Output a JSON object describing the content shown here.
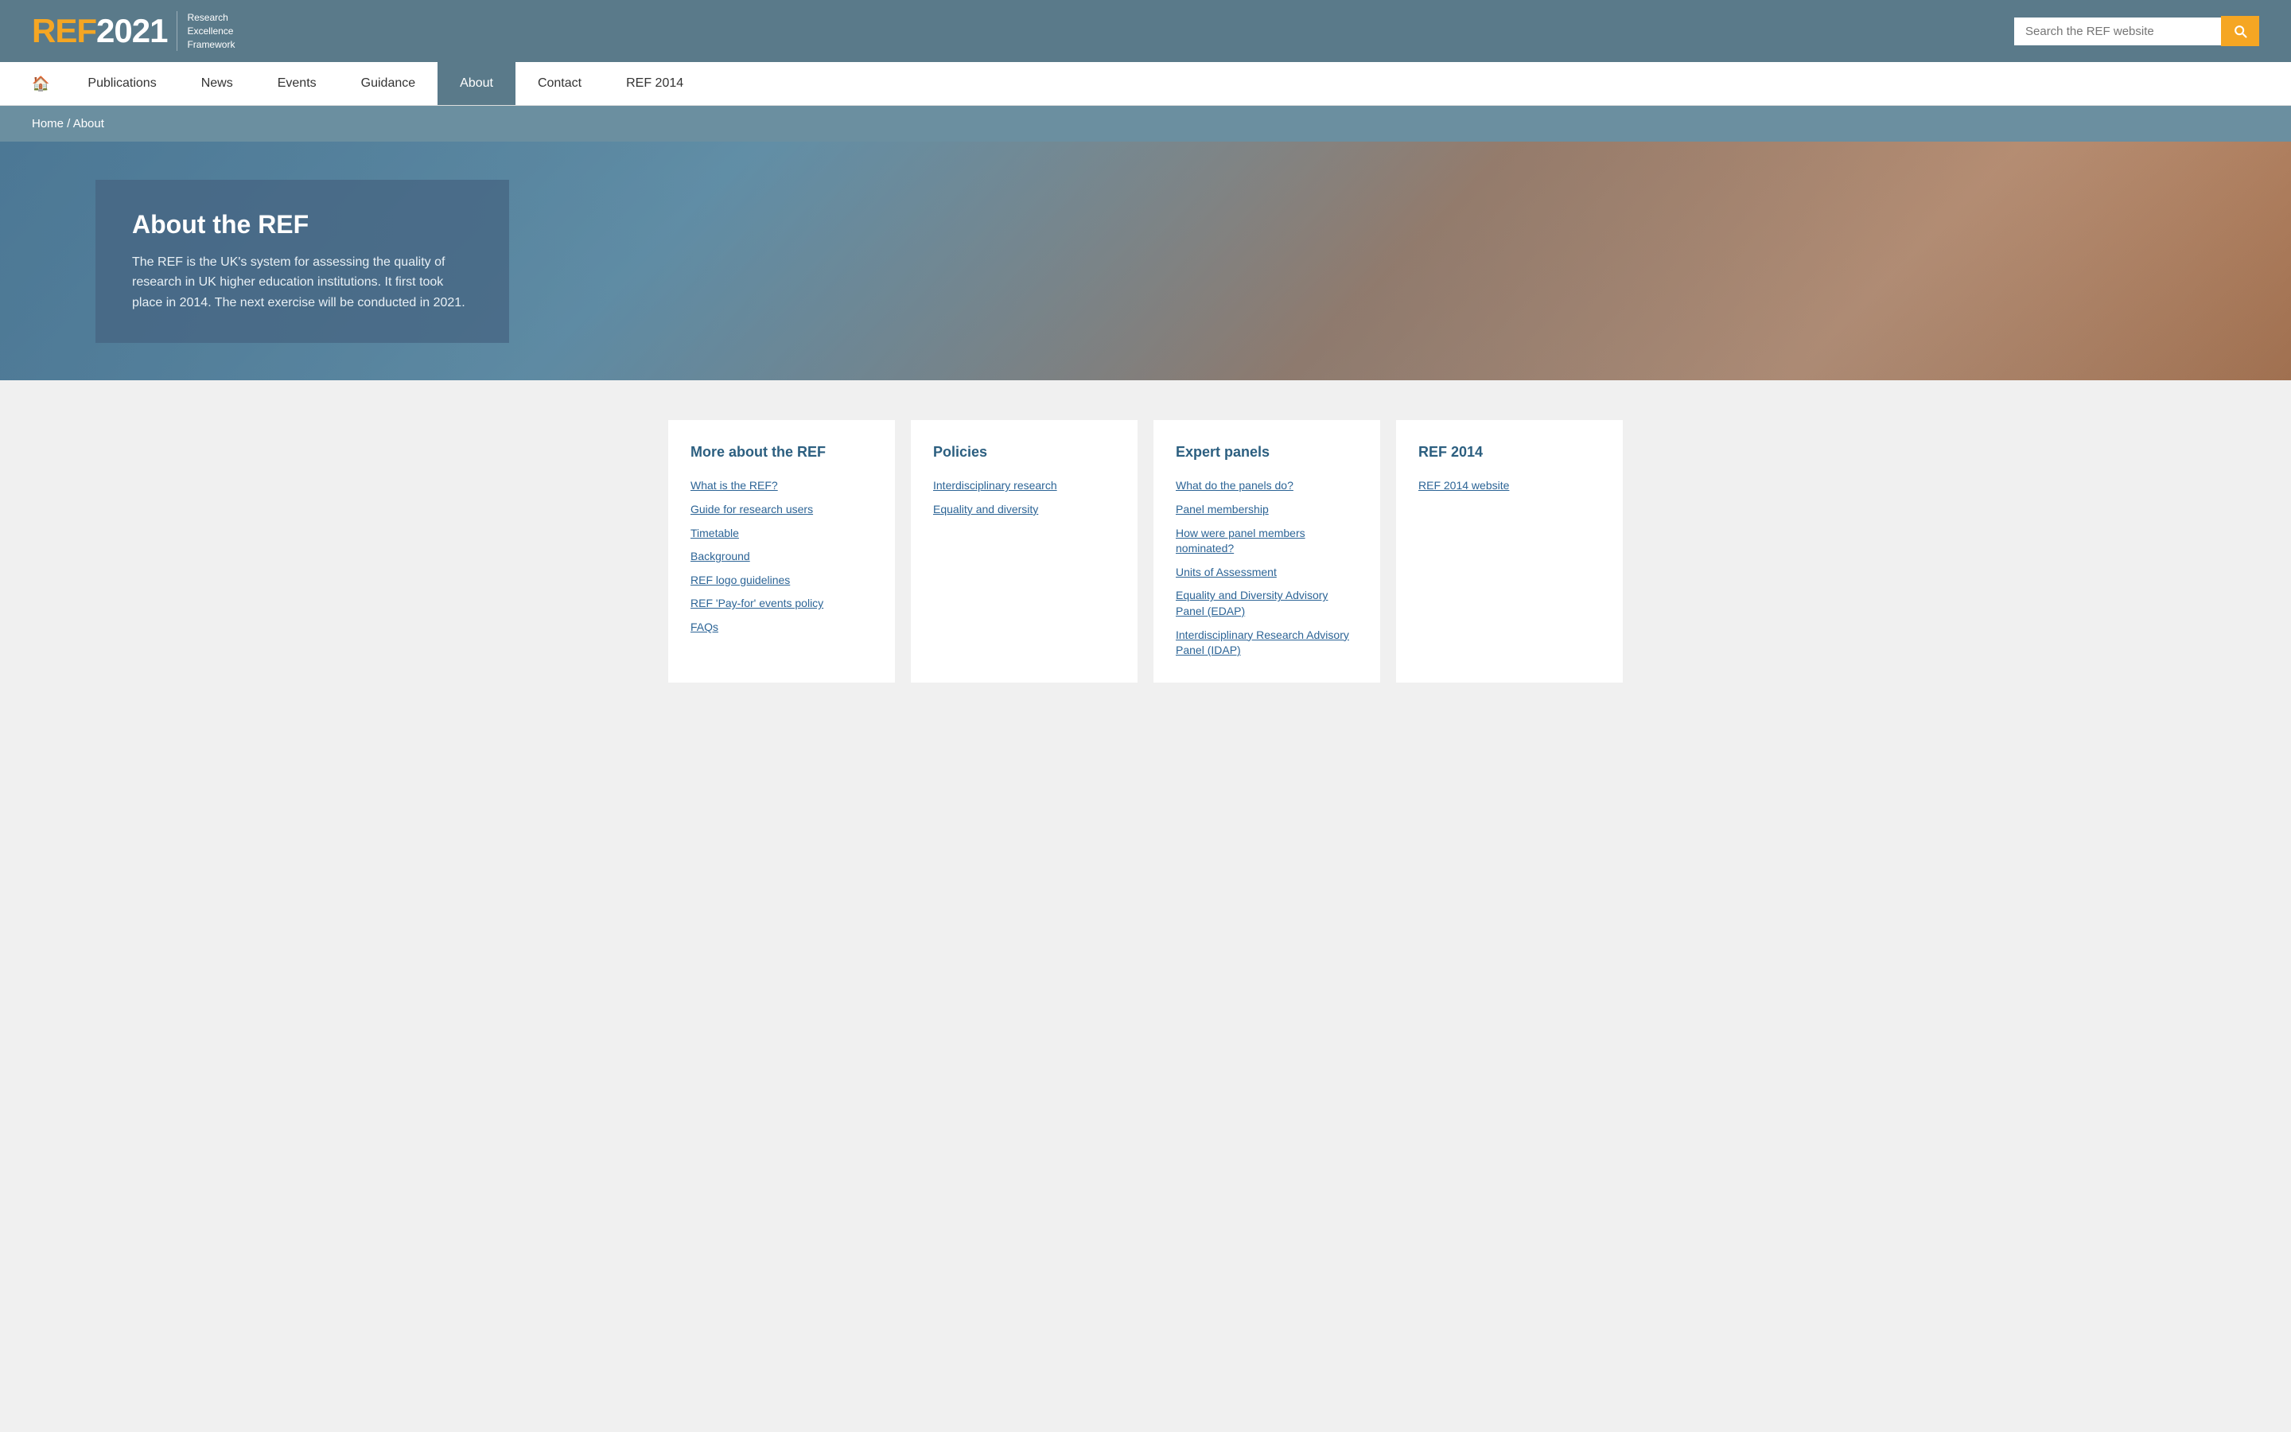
{
  "header": {
    "logo_ref": "REF",
    "logo_year": "2021",
    "logo_line1": "Research",
    "logo_line2": "Excellence",
    "logo_line3": "Framework",
    "search_placeholder": "Search the REF website"
  },
  "nav": {
    "home_icon": "🏠",
    "items": [
      {
        "label": "Publications",
        "active": false
      },
      {
        "label": "News",
        "active": false
      },
      {
        "label": "Events",
        "active": false
      },
      {
        "label": "Guidance",
        "active": false
      },
      {
        "label": "About",
        "active": true
      },
      {
        "label": "Contact",
        "active": false
      },
      {
        "label": "REF 2014",
        "active": false
      }
    ]
  },
  "breadcrumb": {
    "home": "Home",
    "separator": " / ",
    "current": "About"
  },
  "hero": {
    "title": "About the REF",
    "description": "The REF is the UK's system for assessing the quality of research in UK higher education institutions. It first took place in 2014. The next exercise will be conducted in 2021."
  },
  "cards": [
    {
      "id": "more-about",
      "title": "More about the REF",
      "links": [
        "What is the REF?",
        "Guide for research users",
        "Timetable",
        "Background",
        "REF logo guidelines",
        "REF 'Pay-for' events policy",
        "FAQs"
      ]
    },
    {
      "id": "policies",
      "title": "Policies",
      "links": [
        "Interdisciplinary research",
        "Equality and diversity"
      ]
    },
    {
      "id": "expert-panels",
      "title": "Expert panels",
      "links": [
        "What do the panels do?",
        "Panel membership",
        "How were panel members nominated?",
        "Units of Assessment",
        "Equality and Diversity Advisory Panel (EDAP)",
        "Interdisciplinary Research Advisory Panel (IDAP)"
      ]
    },
    {
      "id": "ref-2014",
      "title": "REF 2014",
      "links": [
        "REF 2014 website"
      ]
    }
  ]
}
